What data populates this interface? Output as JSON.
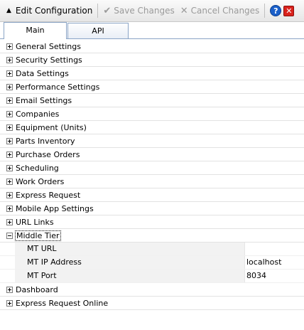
{
  "toolbar": {
    "edit_label": "Edit Configuration",
    "save_label": "Save Changes",
    "cancel_label": "Cancel Changes",
    "help_glyph": "?",
    "close_glyph": "✕"
  },
  "tabs": [
    {
      "label": "Main",
      "active": true
    },
    {
      "label": "API",
      "active": false
    }
  ],
  "tree": {
    "before": [
      "General Settings",
      "Security Settings",
      "Data Settings",
      "Performance Settings",
      "Email Settings",
      "Companies",
      "Equipment (Units)",
      "Parts Inventory",
      "Purchase Orders",
      "Scheduling",
      "Work Orders",
      "Express Request",
      "Mobile App Settings",
      "URL Links"
    ],
    "expanded": {
      "label": "Middle Tier",
      "properties": [
        {
          "name": "MT URL",
          "value": ""
        },
        {
          "name": "MT IP Address",
          "value": "localhost"
        },
        {
          "name": "MT Port",
          "value": "8034"
        }
      ]
    },
    "after": [
      "Dashboard",
      "Express Request Online"
    ]
  }
}
